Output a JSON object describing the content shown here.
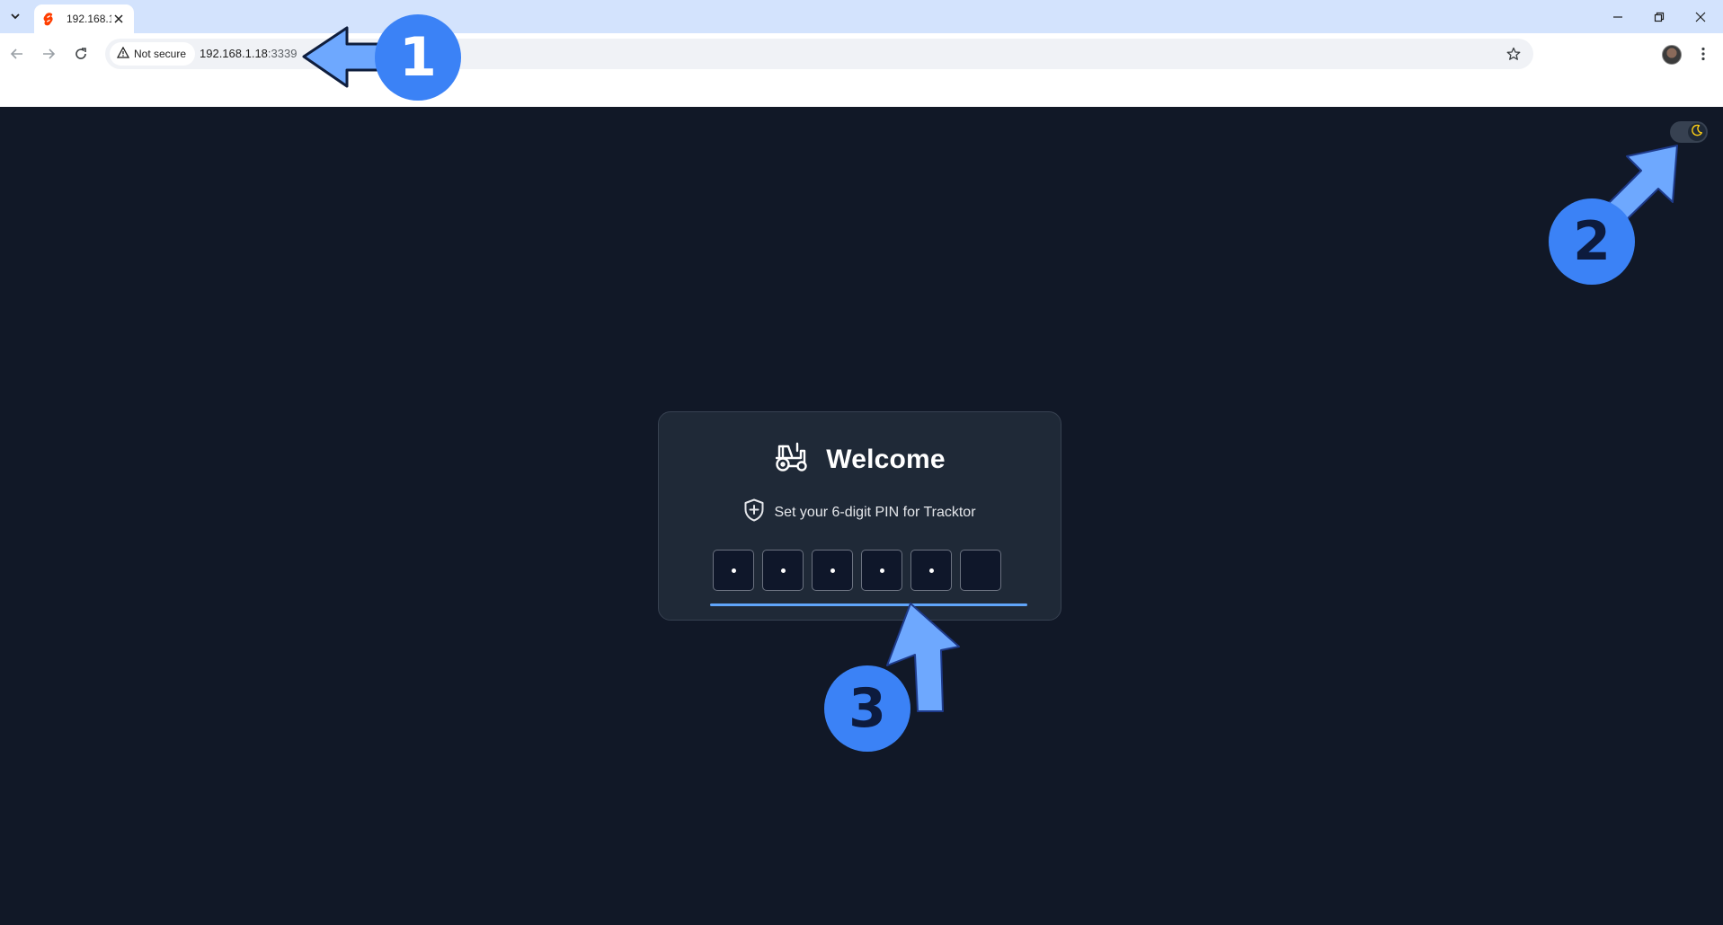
{
  "browser": {
    "tab": {
      "title": "192.168.1.18:3339",
      "favicon": "svelte-logo-icon"
    },
    "security_label": "Not secure",
    "url_host": "192.168.1.18",
    "url_port": ":3339",
    "window_controls": [
      "minimize-icon",
      "restore-icon",
      "close-icon"
    ]
  },
  "theme_toggle": {
    "icon": "moon-icon",
    "accent": "#facc15"
  },
  "card": {
    "icon": "tractor-icon",
    "title": "Welcome",
    "subtitle_icon": "shield-plus-icon",
    "subtitle": "Set your 6-digit PIN for Tracktor",
    "pin": {
      "length": 6,
      "filled": 5,
      "focus_color": "#60a5fa"
    }
  },
  "annotations": {
    "badges": [
      "1",
      "2",
      "3"
    ],
    "color": "#3b82f6",
    "arrow_color": "#6ea8fe"
  },
  "colors": {
    "page_bg": "#111827",
    "card_bg": "#1f2937",
    "tabstrip_bg": "#d3e3fd"
  }
}
